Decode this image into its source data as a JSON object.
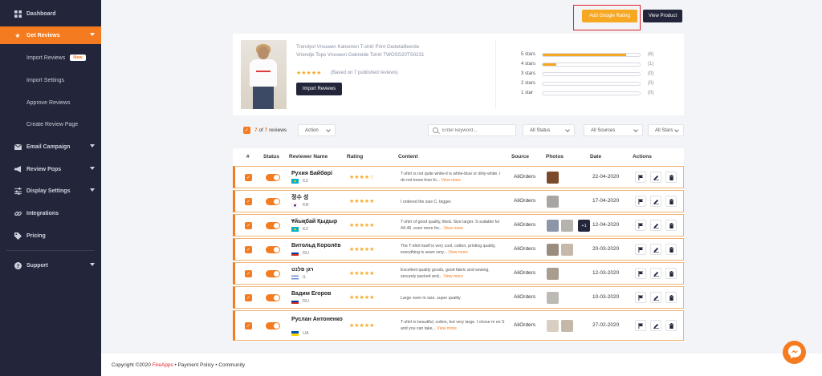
{
  "sidebar": {
    "items": [
      {
        "label": "Dashboard",
        "icon": "dashboard-icon"
      },
      {
        "label": "Get Reviews",
        "icon": "star-icon",
        "active": true
      },
      {
        "label": "Email Campaign",
        "icon": "mail-icon"
      },
      {
        "label": "Review Pops",
        "icon": "megaphone-icon"
      },
      {
        "label": "Display Settings",
        "icon": "sliders-icon"
      },
      {
        "label": "Integrations",
        "icon": "link-icon"
      },
      {
        "label": "Pricing",
        "icon": "tag-icon"
      },
      {
        "label": "Support",
        "icon": "help-icon"
      }
    ],
    "sub_items": [
      {
        "label": "Import Reviews",
        "badge": "New"
      },
      {
        "label": "Import Settings"
      },
      {
        "label": "Approve Reviews"
      },
      {
        "label": "Create Review Page"
      }
    ]
  },
  "top_actions": {
    "google_rating": "Add Google Rating",
    "view_product": "View Product"
  },
  "product": {
    "title": "Trendyol Vrouwen Katoenen T-shirt Print Gedetailleerde Vriendje Tops Vrouwen Gebreide Tshirt TWOSS20TS0231",
    "stars": "★★★★★",
    "based_on": "(Based on 7 published reviews)",
    "import_button": "Import Reviews",
    "ratings": [
      {
        "label": "5 stars",
        "count": "(6)",
        "fraction": 0.86
      },
      {
        "label": "4 stars",
        "count": "(1)",
        "fraction": 0.14
      },
      {
        "label": "3 stars",
        "count": "(0)",
        "fraction": 0
      },
      {
        "label": "2 stars",
        "count": "(0)",
        "fraction": 0
      },
      {
        "label": "1 star",
        "count": "(0)",
        "fraction": 0
      }
    ]
  },
  "toolbar": {
    "selected": "7",
    "of_word": "of",
    "total": "7",
    "reviews_word": "reviews",
    "action": "Action",
    "search_placeholder": "Enter keyword...",
    "status_filter": "All Status",
    "sources_filter": "All Sources",
    "stars_filter": "All Stars"
  },
  "table": {
    "headers": [
      "#",
      "Status",
      "Reviewer Name",
      "Rating",
      "Content",
      "Source",
      "Photos",
      "Date",
      "Actions"
    ],
    "rows": [
      {
        "name": "Рухия Байбөрі",
        "country": "KZ",
        "flag": "kz",
        "stars": "★★★★☆",
        "content": "T-shirt is not quite white-it is white-blue or dirty-white. I do not know how fo...",
        "more": "View more",
        "source": "AliOrders",
        "photos": [
          "#7a4a2a"
        ],
        "extra": "",
        "date": "22-04-2020"
      },
      {
        "name": "정수 성",
        "country": "KR",
        "flag": "kr",
        "stars": "★★★★★",
        "content": "I ordered the size C. bigger.",
        "more": "",
        "source": "AliOrders",
        "photos": [
          "#a8a5a2"
        ],
        "extra": "",
        "date": "17-04-2020"
      },
      {
        "name": "Ұйықбай Қыдыр",
        "country": "KZ",
        "flag": "kz",
        "stars": "★★★★★",
        "content": "T-shirt of good quality, liked. Size larger. S-suitable for 44-46. even more for...",
        "more": "View more",
        "source": "AliOrders",
        "photos": [
          "#8d96a8",
          "#b6b2ad"
        ],
        "extra": "+1",
        "date": "12-04-2020"
      },
      {
        "name": "Витольд Королёв",
        "country": "RU",
        "flag": "ru",
        "stars": "★★★★★",
        "content": "The T-shirt itself is very cool, cotton, printing quality, everything is sewn very...",
        "more": "View more",
        "source": "AliOrders",
        "photos": [
          "#9a8d80",
          "#c7b9a9"
        ],
        "extra": "",
        "date": "20-03-2020"
      },
      {
        "name": "רגן פלנט",
        "country": "IL",
        "flag": "il",
        "stars": "★★★★★",
        "content": "Excellent quality goods, good fabric and sewing, securely packed and...",
        "more": "View more",
        "source": "AliOrders",
        "photos": [
          "#a99d8f"
        ],
        "extra": "",
        "date": "12-03-2020"
      },
      {
        "name": "Вадим Егоров",
        "country": "RU",
        "flag": "ru",
        "stars": "★★★★★",
        "content": "Large oven m size. super quality",
        "more": "",
        "source": "AliOrders",
        "photos": [
          "#bdbab6"
        ],
        "extra": "",
        "date": "10-03-2020"
      },
      {
        "name": "Руслан Антоненко",
        "country": "UA",
        "flag": "ua",
        "stars": "★★★★★",
        "content": "T-shirt is beautiful, cotton, but very large. I chose m on S and you can take...",
        "more": "View more",
        "source": "AliOrders",
        "photos": [
          "#d8cfc2",
          "#c4b8a8"
        ],
        "extra": "",
        "date": "27-02-2020"
      }
    ]
  },
  "footer": {
    "copyright": "Copyright ©2020",
    "brand": "FireApps",
    "links": "• Payment Policy • Community"
  },
  "colors": {
    "accent": "#f47b20",
    "sidebar_bg": "#23263a",
    "star": "#f7a823",
    "highlight": "#e0202a"
  }
}
